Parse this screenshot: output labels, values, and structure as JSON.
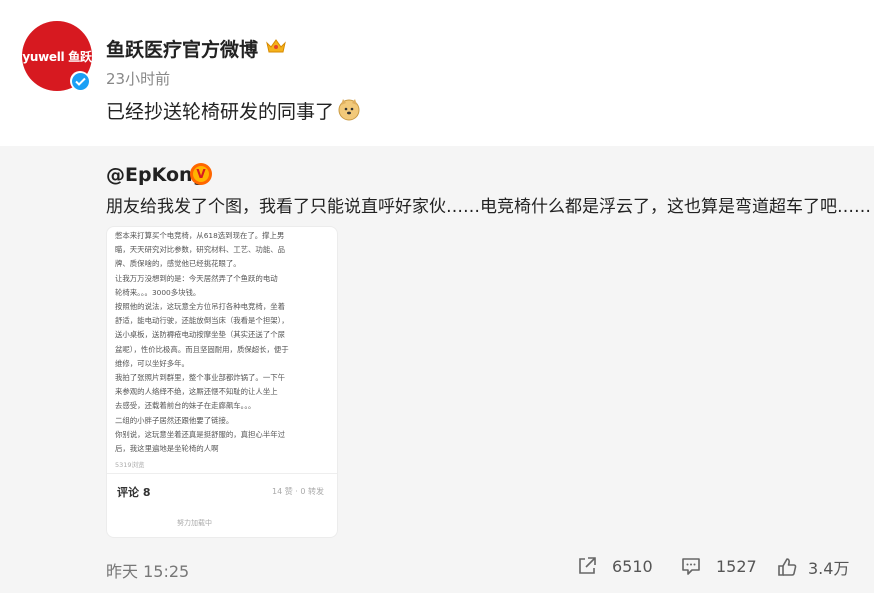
{
  "account": {
    "avatar_text": "yuwell 鱼跃",
    "name": "鱼跃医疗官方微博",
    "time": "23小时前"
  },
  "post": {
    "text": "已经抄送轮椅研发的同事了"
  },
  "repost": {
    "user": "@EpKong",
    "badge": "V",
    "text": "朋友给我发了个图，我看了只能说直呼好家伙……电竞椅什么都是浮云了，这也算是弯道超车了吧……",
    "screenshot": {
      "lines": [
        "憋本来打算买个电竞椅，从618选到现在了。撑上男",
        "瞄，天天研究对比参数，研究材料、工艺、功能、品",
        "牌、质保啥的，感觉他已经挑花眼了。",
        "让我万万没想到的是：今天居然弄了个鱼跃的电动",
        "轮椅来。。。3000多块钱。",
        "按照他的说法，这玩意全方位吊打各种电竞椅，坐着",
        "舒适，能电动行驶，还能放倒当床（我看是个担架），",
        "送小桌板，送防褥疮电动按摩坐垫（其实还送了个尿",
        "盆呢），性价比极高。而且坚固耐用，质保超长，便于",
        "维修，可以坐好多年。",
        "我拍了张照片到群里，整个事业部都炸锅了。一下午",
        "来参观的人络绎不绝，这厮还惬不知耻的让人坐上",
        "去感受，还载着前台的妹子在走廊飙车。。。",
        "二组的小胖子居然还跟他要了链接。",
        "你别说，这玩意坐着还真是挺舒服的，真担心半年过",
        "后，我这里遍地是坐轮椅的人啊"
      ],
      "meta": "5319浏览",
      "comments": "评论 8",
      "stats": "14 赞 · 0 转发",
      "footer": "努力加载中"
    }
  },
  "footer": {
    "date": "昨天 15:25",
    "reposts": "6510",
    "comments": "1527",
    "likes": "3.4万"
  },
  "colors": {
    "brand_red": "#d71920",
    "verified_blue": "#1a9ff5",
    "v_orange": "#ff6600",
    "repost_bg": "#f5f5f5"
  }
}
